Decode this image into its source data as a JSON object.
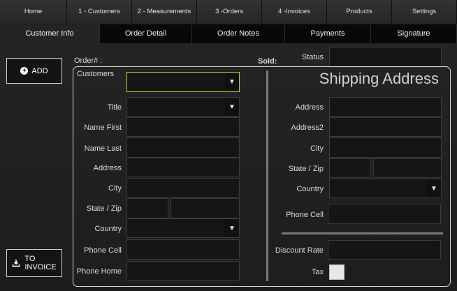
{
  "topnav": [
    "Home",
    "1 - Customers",
    "2 - Measurements",
    "3 -Orders",
    "4 -Invoices",
    "Products",
    "Settings"
  ],
  "subtabs": [
    "Customer Info",
    "Order Detail",
    "Order Notes",
    "Payments",
    "Signature"
  ],
  "active_subtab": "Customer Info",
  "side": {
    "add_label": "ADD",
    "to_invoice_line1": "TO",
    "to_invoice_line2": "INVOICE"
  },
  "header": {
    "order_label": "Order# :",
    "sold_label": "Sold:",
    "status_label": "Status"
  },
  "customer": {
    "customers_label": "Customers",
    "title_label": "Title",
    "name_first_label": "Name First",
    "name_last_label": "Name Last",
    "address_label": "Address",
    "city_label": "City",
    "state_zip_label": "State / Zip",
    "country_label": "Country",
    "phone_cell_label": "Phone Cell",
    "phone_home_label": "Phone Home"
  },
  "shipping": {
    "title": "Shipping Address",
    "address_label": "Address",
    "address2_label": "Address2",
    "city_label": "City",
    "state_zip_label": "State / Zip",
    "country_label": "Country",
    "phone_cell_label": "Phone Cell",
    "discount_rate_label": "Discount Rate",
    "tax_label": "Tax"
  },
  "icons": {
    "dropdown": "chevron-down-icon",
    "add": "plus-circle-icon",
    "invoice": "download-icon"
  },
  "colors": {
    "focus": "#c8c84a",
    "field_bg": "#151515",
    "panel_border": "#d8d8d8"
  }
}
